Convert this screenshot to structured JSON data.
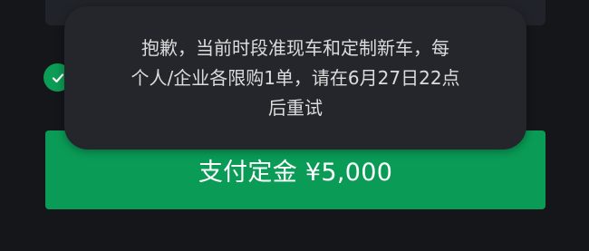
{
  "background_colors": {
    "page": "#14161a",
    "card": "#202329",
    "accent_green": "#0a9c57",
    "toast": "#25262b"
  },
  "agreement": {
    "icon": "check-circle-icon",
    "checked": true
  },
  "pay_button": {
    "label": "支付定金 ¥5,000"
  },
  "toast": {
    "lines": [
      "抱歉，当前时段准现车和定制新车，每",
      "个人/企业各限购1单，请在6月27日22点",
      "后重试"
    ]
  }
}
